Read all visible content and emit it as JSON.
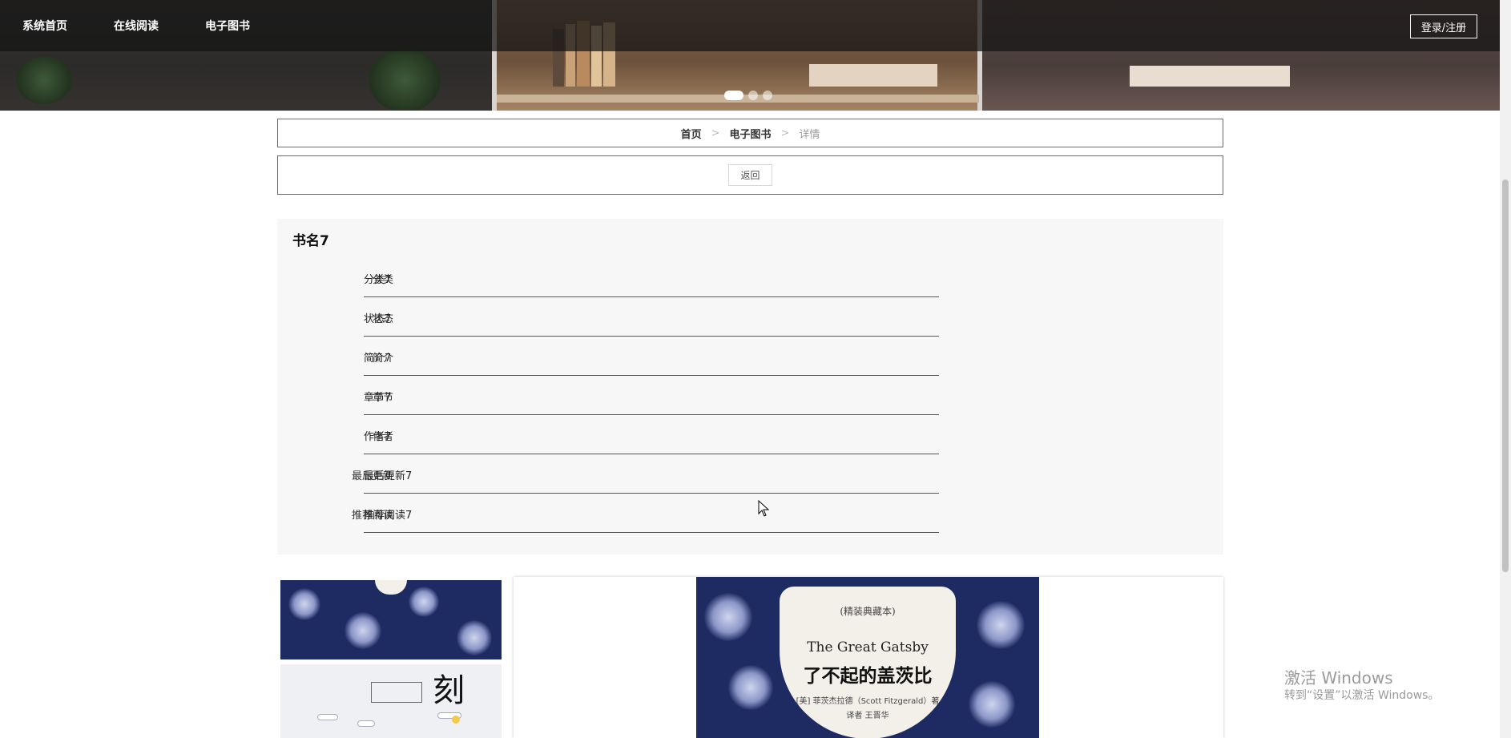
{
  "nav": {
    "items": [
      "系统首页",
      "在线阅读",
      "电子图书"
    ],
    "login_label": "登录/注册"
  },
  "carousel": {
    "slide_count": 3,
    "active_index": 0
  },
  "breadcrumb": {
    "home": "首页",
    "section": "电子图书",
    "current": "详情",
    "separator": ">"
  },
  "back_label": "返回",
  "book": {
    "title": "书名7",
    "fields": [
      {
        "label": "分类",
        "value": "分类7"
      },
      {
        "label": "状态",
        "value": "状态7"
      },
      {
        "label": "简介",
        "value": "简介7"
      },
      {
        "label": "章节",
        "value": "章节7"
      },
      {
        "label": "作者",
        "value": "作者7"
      },
      {
        "label": "最后更新",
        "value": "最后更新7"
      },
      {
        "label": "推荐阅读",
        "value": "推荐阅读7"
      }
    ]
  },
  "cover": {
    "subtitle": "(精装典藏本)",
    "title_en": "The Great Gatsby",
    "title_cn": "了不起的盖茨比",
    "author_line": "[美] 菲茨杰拉德（Scott Fitzgerald）著",
    "translator_line": "译者 王晋华"
  },
  "thumb2": {
    "big_text": "刻"
  },
  "watermark": {
    "line1": "激活 Windows",
    "line2": "转到“设置”以激活 Windows。"
  },
  "colors": {
    "nav_bg": "#141414",
    "cover_navy": "#1e2b63",
    "panel_bg": "#f8f7f8"
  }
}
